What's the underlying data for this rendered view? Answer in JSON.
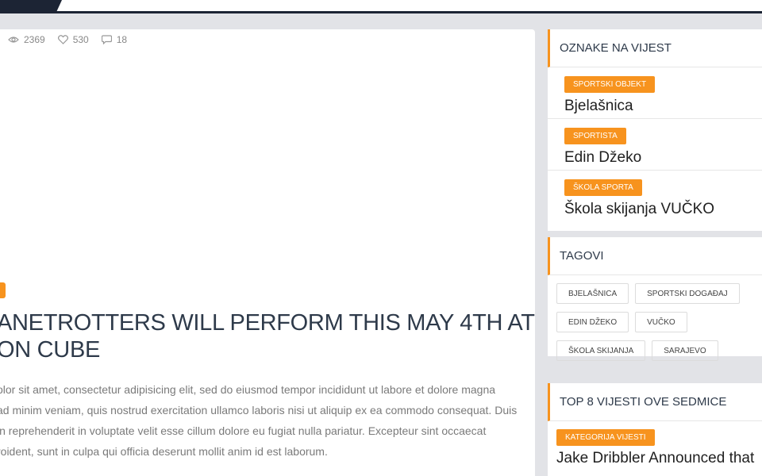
{
  "stats": {
    "views": "2369",
    "likes": "530",
    "comments": "18"
  },
  "article": {
    "headline_line1": "ANETROTTERS WILL PERFORM THIS MAY 4TH AT",
    "headline_line2": "ON CUBE",
    "body_lines": [
      "olor sit amet, consectetur adipisicing elit, sed do eiusmod tempor incididunt ut labore et dolore magna",
      "ad minim veniam, quis nostrud exercitation ullamco laboris nisi ut aliquip ex ea commodo consequat. Duis",
      "in reprehenderit in voluptate velit esse cillum dolore eu fugiat nulla pariatur. Excepteur sint occaecat",
      "roident, sunt in culpa qui officia deserunt mollit anim id est laborum."
    ]
  },
  "oznake": {
    "title": "OZNAKE NA VIJEST",
    "items": [
      {
        "badge": "SPORTSKI OBJEKT",
        "name": "Bjelašnica"
      },
      {
        "badge": "SPORTISTA",
        "name": "Edin Džeko"
      },
      {
        "badge": "ŠKOLA SPORTA",
        "name": "Škola skijanja VUČKO"
      }
    ]
  },
  "tagovi": {
    "title": "TAGOVI",
    "tags": [
      "BJELAŠNICA",
      "SPORTSKI DOGAĐAJ",
      "EDIN DŽEKO",
      "VUČKO",
      "ŠKOLA SKIJANJA",
      "SARAJEVO"
    ]
  },
  "top8": {
    "title": "TOP 8 VIJESTI OVE SEDMICE",
    "badge": "KATEGORIJA VIJESTI",
    "headline": "Jake Dribbler Announced that"
  },
  "colors": {
    "accent": "#f7931e",
    "navy": "#1c2434",
    "background": "#e2e3e7"
  },
  "icons": [
    "eye-icon",
    "heart-icon",
    "comment-icon"
  ]
}
